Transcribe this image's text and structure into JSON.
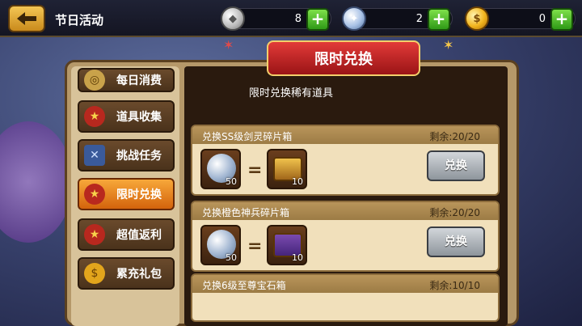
{
  "header": {
    "back_label": "back",
    "title": "节日活动",
    "resources": [
      {
        "icon": "silver-coin-icon",
        "value": "8"
      },
      {
        "icon": "diamond-gem-icon",
        "value": "2"
      },
      {
        "icon": "gold-coin-icon",
        "value": "0"
      }
    ]
  },
  "banner": {
    "title": "限时兑换"
  },
  "sidebar": {
    "items": [
      {
        "label": "每日消费",
        "icon": "coins-icon"
      },
      {
        "label": "道具收集",
        "icon": "medal-icon"
      },
      {
        "label": "挑战任务",
        "icon": "card-icon"
      },
      {
        "label": "限时兑换",
        "icon": "medal-icon",
        "active": true
      },
      {
        "label": "超值返利",
        "icon": "medal-icon"
      },
      {
        "label": "累充礼包",
        "icon": "gold-coin-icon"
      }
    ]
  },
  "main": {
    "subtitle": "限时兑换稀有道具",
    "cards": [
      {
        "title": "兑换SS级剑灵碎片箱",
        "remaining": "剩余:20/20",
        "cost_count": "50",
        "reward_count": "10",
        "button": "兑换"
      },
      {
        "title": "兑换橙色神兵碎片箱",
        "remaining": "剩余:20/20",
        "cost_count": "50",
        "reward_count": "10",
        "button": "兑换"
      },
      {
        "title": "兑换6级至尊宝石箱",
        "remaining": "剩余:10/10"
      }
    ]
  }
}
